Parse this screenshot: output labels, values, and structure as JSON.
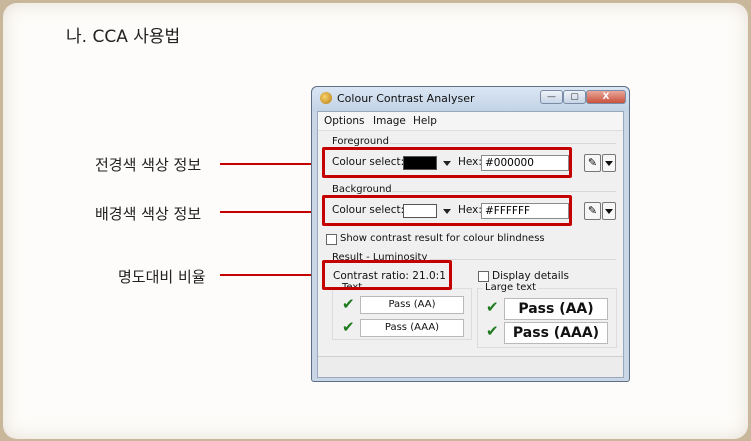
{
  "slide": {
    "title": "나. CCA 사용법",
    "callouts": [
      "전경색 색상 정보",
      "배경색 색상 정보",
      "명도대비 비율"
    ]
  },
  "window": {
    "title": "Colour Contrast Analyser",
    "controls": {
      "minimize": "—",
      "maximize": "▢",
      "close": "X"
    },
    "menu": [
      "Options",
      "Image",
      "Help"
    ]
  },
  "foreground": {
    "group_label": "Foreground",
    "colour_select_label": "Colour select:",
    "swatch_color": "#000000",
    "hex_label": "Hex:",
    "hex_value": "#000000"
  },
  "background": {
    "group_label": "Background",
    "colour_select_label": "Colour select:",
    "swatch_color": "#FFFFFF",
    "hex_label": "Hex:",
    "hex_value": "#FFFFFF"
  },
  "options": {
    "colour_blindness_label": "Show contrast result for colour blindness",
    "display_details_label": "Display details"
  },
  "result": {
    "group_label": "Result - Luminosity",
    "contrast_ratio": "Contrast ratio: 21.0:1",
    "text_label": "Text",
    "large_text_label": "Large text",
    "text_aa": "Pass (AA)",
    "text_aaa": "Pass (AAA)",
    "large_aa": "Pass (AA)",
    "large_aaa": "Pass (AAA)"
  },
  "colors": {
    "highlight": "#c40000",
    "pass_check": "#1c7a1c"
  },
  "icons": {
    "eyedropper": "eyedropper-icon",
    "check": "checkmark-icon",
    "app": "app-icon"
  }
}
